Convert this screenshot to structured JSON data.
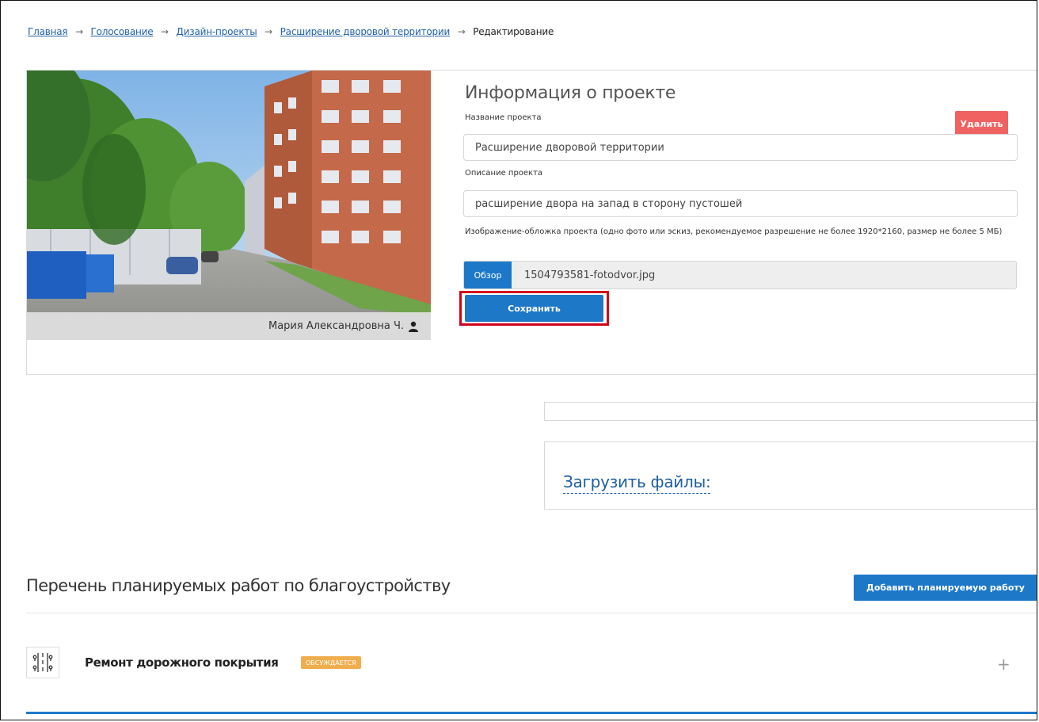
{
  "breadcrumb": {
    "items": [
      "Главная",
      "Голосование",
      "Дизайн-проекты",
      "Расширение дворовой территории"
    ],
    "current": "Редактирование",
    "separator": "→"
  },
  "project": {
    "photo_author": "Мария Александровна Ч.",
    "info_title": "Информация о проекте",
    "delete_label": "Удалить",
    "name_label": "Название проекта",
    "name_value": "Расширение дворовой территории",
    "description_label": "Описание проекта",
    "description_value": "расширение двора на запад в сторону пустошей",
    "cover_hint": "Изображение-обложка проекта (одно фото или эскиз, рекомендуемое разрешение не более 1920*2160, размер не более 5 МБ)",
    "browse_label": "Обзор",
    "file_name": "1504793581-fotodvor.jpg",
    "save_label": "Сохранить"
  },
  "upload": {
    "link_label": "Загрузить файлы:"
  },
  "works": {
    "title": "Перечень планируемых работ по благоустройству",
    "add_label": "Добавить планируемую работу",
    "items": [
      {
        "name": "Ремонт дорожного покрытия",
        "status": "обсуждается",
        "expand": "+"
      }
    ]
  },
  "colors": {
    "primary": "#1d78c8",
    "danger": "#f06262",
    "highlight": "#d0021b",
    "badge": "#f0ad4e",
    "link": "#2361a8"
  }
}
